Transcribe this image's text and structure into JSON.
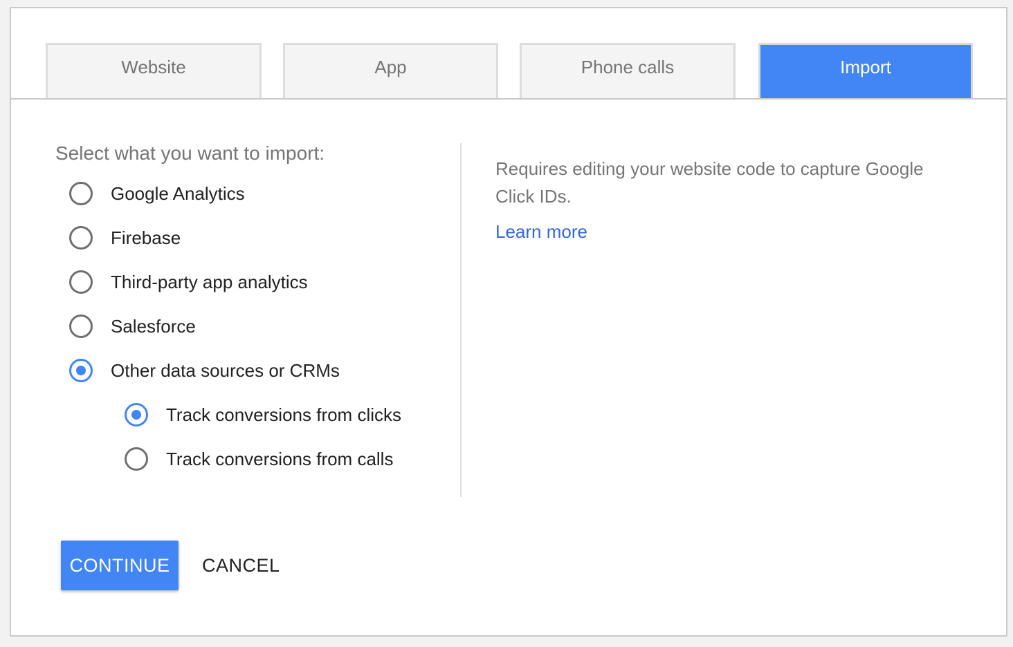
{
  "tabs": [
    {
      "label": "Website",
      "active": false
    },
    {
      "label": "App",
      "active": false
    },
    {
      "label": "Phone calls",
      "active": false
    },
    {
      "label": "Import",
      "active": true
    }
  ],
  "import_section": {
    "prompt": "Select what you want to import:",
    "options": [
      {
        "label": "Google Analytics",
        "checked": false
      },
      {
        "label": "Firebase",
        "checked": false
      },
      {
        "label": "Third-party app analytics",
        "checked": false
      },
      {
        "label": "Salesforce",
        "checked": false
      },
      {
        "label": "Other data sources or CRMs",
        "checked": true
      }
    ],
    "sub_options": [
      {
        "label": "Track conversions from clicks",
        "checked": true
      },
      {
        "label": "Track conversions from calls",
        "checked": false
      }
    ]
  },
  "info": {
    "description": "Requires editing your website code to capture Google Click IDs.",
    "learn_more": "Learn more"
  },
  "actions": {
    "continue_label": "CONTINUE",
    "cancel_label": "CANCEL"
  },
  "colors": {
    "accent": "#4285f4",
    "link": "#3367d6"
  }
}
